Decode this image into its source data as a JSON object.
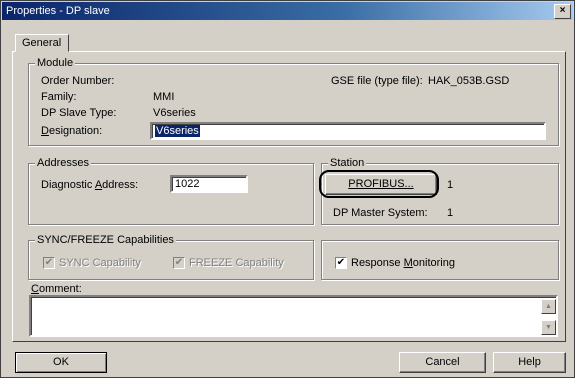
{
  "window": {
    "title": "Properties - DP slave",
    "close_label": "×"
  },
  "tabs": [
    {
      "label": "General"
    }
  ],
  "module": {
    "legend": "Module",
    "order_number_label": "Order Number:",
    "order_number_value": "",
    "gse_file_label": "GSE file (type file):",
    "gse_file_value": "HAK_053B.GSD",
    "family_label": "Family:",
    "family_value": "MMI",
    "dp_slave_type_label": "DP Slave Type:",
    "dp_slave_type_value": "V6series",
    "designation_label": "Designation:",
    "designation_value": "V6series"
  },
  "addresses": {
    "legend": "Addresses",
    "diagnostic_label": "Diagnostic Address:",
    "diagnostic_value": "1022"
  },
  "station": {
    "legend": "Station",
    "profibus_button": "PROFIBUS...",
    "profibus_value": "1",
    "dp_master_label": "DP Master System:",
    "dp_master_value": "1"
  },
  "sync_freeze": {
    "legend": "SYNC/FREEZE Capabilities",
    "sync_label": "SYNC Capability",
    "sync_checked": true,
    "freeze_label": "FREEZE Capability",
    "freeze_checked": true
  },
  "response_monitoring": {
    "label": "Response Monitoring",
    "checked": true
  },
  "comment": {
    "label": "Comment:",
    "value": ""
  },
  "footer": {
    "ok_label": "OK",
    "cancel_label": "Cancel",
    "help_label": "Help"
  },
  "glyphs": {
    "check": "✔",
    "scroll_up": "▲",
    "scroll_down": "▼"
  }
}
